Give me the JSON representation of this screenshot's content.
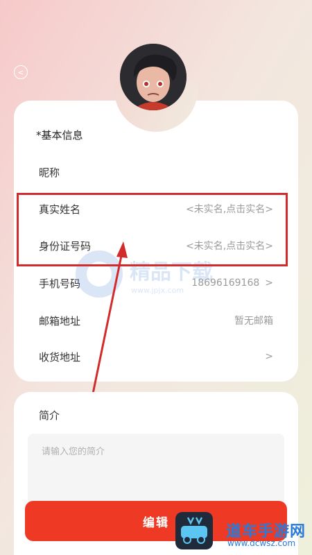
{
  "header": {
    "back_icon": "chevron-left-icon"
  },
  "profile": {
    "avatar_alt": "avatar"
  },
  "section": {
    "title": "*基本信息"
  },
  "fields": [
    {
      "label": "昵称",
      "value": ""
    },
    {
      "label": "真实姓名",
      "value": "<未实名,点击实名>"
    },
    {
      "label": "身份证号码",
      "value": "<未实名,点击实名>"
    },
    {
      "label": "手机号码",
      "value": "18696169168"
    },
    {
      "label": "邮箱地址",
      "value": "暂无邮箱"
    },
    {
      "label": "收货地址",
      "value": ""
    }
  ],
  "chevron": ">",
  "intro": {
    "title": "简介",
    "placeholder": "请输入您的简介"
  },
  "edit_button": {
    "label": "编辑"
  },
  "watermark": {
    "text": "精品下载",
    "url": "www.jpjx.com"
  },
  "brand": {
    "name": "道车手游网",
    "url": "www.dcwsz.com"
  },
  "colors": {
    "accent": "#ee3a24",
    "highlight": "#d22b2b",
    "brand": "#2a7bd8"
  }
}
